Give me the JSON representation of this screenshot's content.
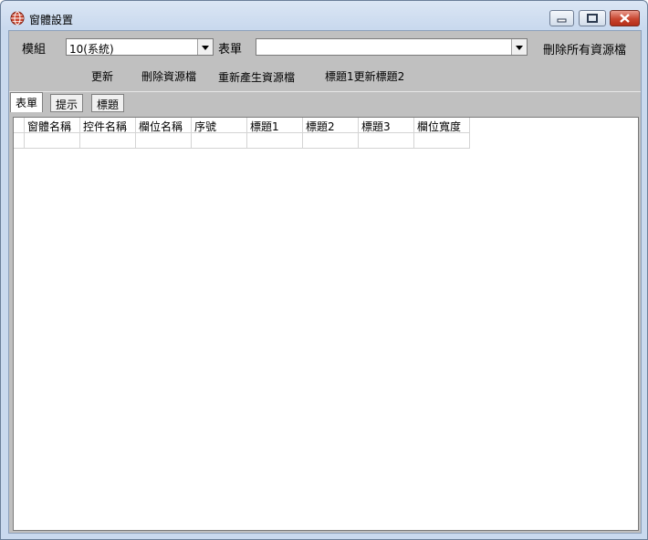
{
  "window": {
    "title": "窗體設置",
    "icon": "globe-app-icon"
  },
  "toolbar": {
    "module_label": "模組",
    "module_value": "10(系統)",
    "form_label": "表單",
    "form_value": "",
    "delete_all_label": "刪除所有資源檔",
    "update_label": "更新",
    "delete_res_label": "刪除資源檔",
    "regen_label": "重新產生資源檔",
    "title_update_label": "標題1更新標題2"
  },
  "tabs": [
    {
      "label": "表單",
      "active": true
    },
    {
      "label": "提示",
      "active": false
    },
    {
      "label": "標題",
      "active": false
    }
  ],
  "grid": {
    "columns": [
      "窗體名稱",
      "控件名稱",
      "欄位名稱",
      "序號",
      "標題1",
      "標題2",
      "標題3",
      "欄位寬度"
    ],
    "rows": [
      [
        "",
        "",
        "",
        "",
        "",
        "",
        "",
        ""
      ]
    ]
  },
  "colors": {
    "frame": "#c9d9ee",
    "client": "#c0c0c0",
    "close_button": "#c8452f"
  }
}
